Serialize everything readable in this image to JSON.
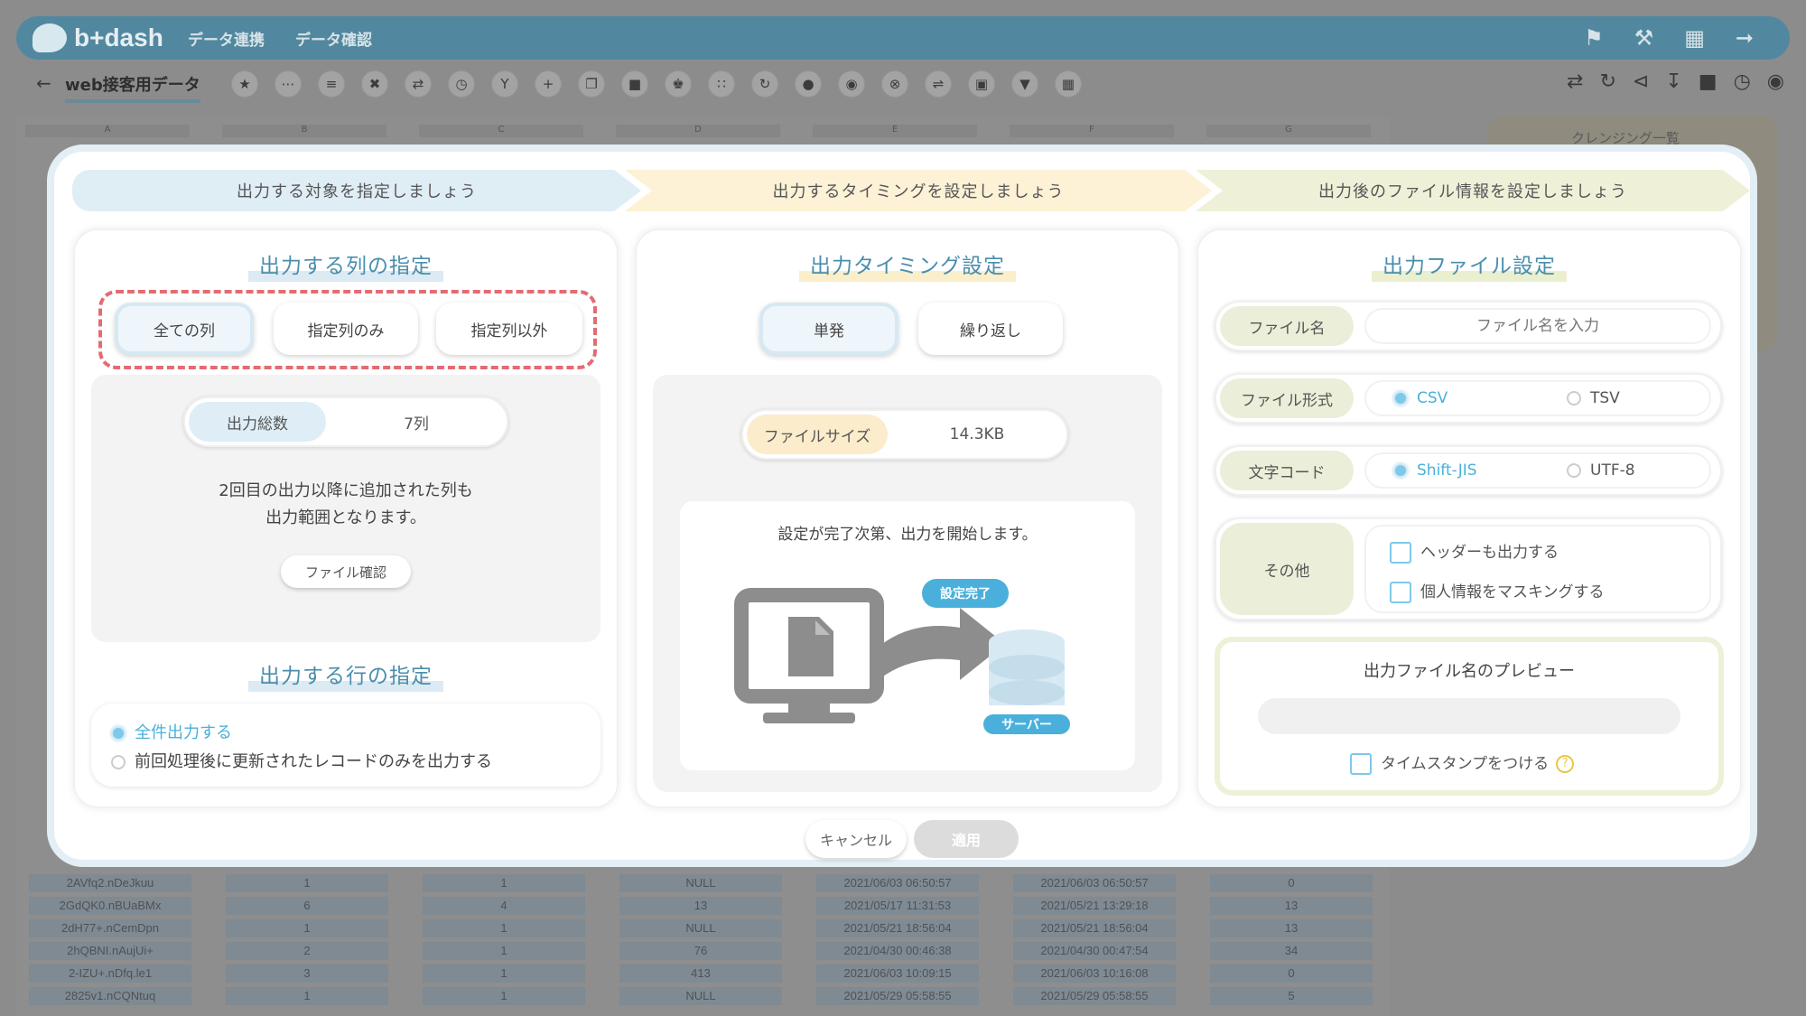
{
  "app": {
    "logo_text": "b+dash",
    "nav": [
      "データ連携",
      "データ確認"
    ],
    "top_icons": [
      "bell-icon",
      "wrench-icon",
      "apps-grid-icon",
      "logout-icon"
    ]
  },
  "toolbar": {
    "back_icon": "back-arrow-icon",
    "sheet_title": "web接客用データ",
    "tool_icons": [
      "star-icon",
      "more-icon",
      "list-icon",
      "tools-icon",
      "expand-icon",
      "timer-icon",
      "merge-icon",
      "add-icon",
      "copy-icon",
      "trash-icon",
      "crown-icon",
      "scatter-icon",
      "loop-icon",
      "api-icon",
      "bucket-icon",
      "cancel-icon",
      "transform-icon",
      "frame-icon",
      "filter-icon",
      "table-icon"
    ],
    "right_icons": [
      "repeat-icon",
      "sync-icon",
      "share-icon",
      "download-icon",
      "delete-icon",
      "history-icon",
      "save-icon"
    ]
  },
  "background": {
    "columns": [
      "A",
      "B",
      "C",
      "D",
      "E",
      "F",
      "G"
    ],
    "side_panel_title": "クレンジング一覧",
    "rows": [
      [
        "2AVfq2.nDeJkuu",
        "1",
        "1",
        "NULL",
        "2021/06/03 06:50:57",
        "2021/06/03 06:50:57",
        "0"
      ],
      [
        "2GdQK0.nBUaBMx",
        "6",
        "4",
        "13",
        "2021/05/17 11:31:53",
        "2021/05/21 13:29:18",
        "13"
      ],
      [
        "2dH77+.nCemDpn",
        "1",
        "1",
        "NULL",
        "2021/05/21 18:56:04",
        "2021/05/21 18:56:04",
        "13"
      ],
      [
        "2hQBNI.nAujUi+",
        "2",
        "1",
        "76",
        "2021/04/30 00:46:38",
        "2021/04/30 00:47:54",
        "34"
      ],
      [
        "2-IZU+.nDfq.le1",
        "3",
        "1",
        "413",
        "2021/06/03 10:09:15",
        "2021/06/03 10:16:08",
        "0"
      ],
      [
        "2825v1.nCQNtuq",
        "1",
        "1",
        "NULL",
        "2021/05/29 05:58:55",
        "2021/05/29 05:58:55",
        "5"
      ]
    ]
  },
  "steps": [
    "出力する対象を指定しましょう",
    "出力するタイミングを設定しましょう",
    "出力後のファイル情報を設定しましょう"
  ],
  "columns_panel": {
    "title": "出力する列の指定",
    "options": [
      "全ての列",
      "指定列のみ",
      "指定列以外"
    ],
    "selected": "全ての列",
    "total_label": "出力総数",
    "total_value": "7列",
    "note_line1": "2回目の出力以降に追加された列も",
    "note_line2": "出力範囲となります。",
    "file_check_button": "ファイル確認",
    "rows_title": "出力する行の指定",
    "row_options": [
      "全件出力する",
      "前回処理後に更新されたレコードのみを出力する"
    ],
    "row_selected": "全件出力する"
  },
  "timing_panel": {
    "title": "出力タイミング設定",
    "options": [
      "単発",
      "繰り返し"
    ],
    "selected": "単発",
    "filesize_label": "ファイルサイズ",
    "filesize_value": "14.3KB",
    "message": "設定が完了次第、出力を開始します。",
    "badge_done": "設定完了",
    "badge_server": "サーバー"
  },
  "file_panel": {
    "title": "出力ファイル設定",
    "filename_label": "ファイル名",
    "filename_placeholder": "ファイル名を入力",
    "format_label": "ファイル形式",
    "format_options": [
      "CSV",
      "TSV"
    ],
    "format_selected": "CSV",
    "encoding_label": "文字コード",
    "encoding_options": [
      "Shift-JIS",
      "UTF-8"
    ],
    "encoding_selected": "Shift-JIS",
    "other_label": "その他",
    "other_options": [
      "ヘッダーも出力する",
      "個人情報をマスキングする"
    ],
    "preview_title": "出力ファイル名のプレビュー",
    "timestamp_label": "タイムスタンプをつける"
  },
  "footer": {
    "cancel": "キャンセル",
    "apply": "適用"
  },
  "colors": {
    "accent": "#4a8eac",
    "selected_radio": "#7ec8ea",
    "dashed_highlight": "#e46b72",
    "filesize_label_bg": "#fbeccb",
    "file_label_bg": "#ebeed8"
  }
}
